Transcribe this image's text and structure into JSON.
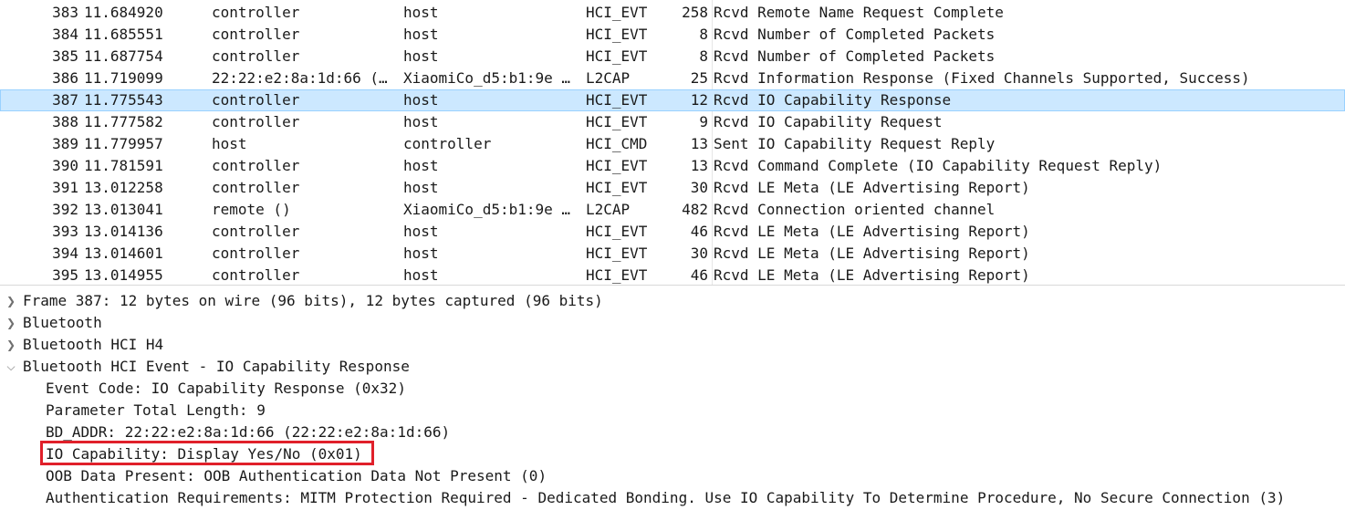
{
  "packets": [
    {
      "no": "383",
      "time": "11.684920",
      "source": "controller",
      "destination": "host",
      "protocol": "HCI_EVT",
      "length": "258",
      "info": "Rcvd Remote Name Request Complete"
    },
    {
      "no": "384",
      "time": "11.685551",
      "source": "controller",
      "destination": "host",
      "protocol": "HCI_EVT",
      "length": "8",
      "info": "Rcvd Number of Completed Packets"
    },
    {
      "no": "385",
      "time": "11.687754",
      "source": "controller",
      "destination": "host",
      "protocol": "HCI_EVT",
      "length": "8",
      "info": "Rcvd Number of Completed Packets"
    },
    {
      "no": "386",
      "time": "11.719099",
      "source": "22:22:e2:8a:1d:66 (…",
      "destination": "XiaomiCo_d5:b1:9e …",
      "protocol": "L2CAP",
      "length": "25",
      "info": "Rcvd Information Response (Fixed Channels Supported, Success)"
    },
    {
      "no": "387",
      "time": "11.775543",
      "source": "controller",
      "destination": "host",
      "protocol": "HCI_EVT",
      "length": "12",
      "info": "Rcvd IO Capability Response"
    },
    {
      "no": "388",
      "time": "11.777582",
      "source": "controller",
      "destination": "host",
      "protocol": "HCI_EVT",
      "length": "9",
      "info": "Rcvd IO Capability Request"
    },
    {
      "no": "389",
      "time": "11.779957",
      "source": "host",
      "destination": "controller",
      "protocol": "HCI_CMD",
      "length": "13",
      "info": "Sent IO Capability Request Reply"
    },
    {
      "no": "390",
      "time": "11.781591",
      "source": "controller",
      "destination": "host",
      "protocol": "HCI_EVT",
      "length": "13",
      "info": "Rcvd Command Complete (IO Capability Request Reply)"
    },
    {
      "no": "391",
      "time": "13.012258",
      "source": "controller",
      "destination": "host",
      "protocol": "HCI_EVT",
      "length": "30",
      "info": "Rcvd LE Meta (LE Advertising Report)"
    },
    {
      "no": "392",
      "time": "13.013041",
      "source": "remote ()",
      "destination": "XiaomiCo_d5:b1:9e …",
      "protocol": "L2CAP",
      "length": "482",
      "info": "Rcvd Connection oriented channel"
    },
    {
      "no": "393",
      "time": "13.014136",
      "source": "controller",
      "destination": "host",
      "protocol": "HCI_EVT",
      "length": "46",
      "info": "Rcvd LE Meta (LE Advertising Report)"
    },
    {
      "no": "394",
      "time": "13.014601",
      "source": "controller",
      "destination": "host",
      "protocol": "HCI_EVT",
      "length": "30",
      "info": "Rcvd LE Meta (LE Advertising Report)"
    },
    {
      "no": "395",
      "time": "13.014955",
      "source": "controller",
      "destination": "host",
      "protocol": "HCI_EVT",
      "length": "46",
      "info": "Rcvd LE Meta (LE Advertising Report)"
    }
  ],
  "selected_packet": "387",
  "details": {
    "frame": "Frame 387: 12 bytes on wire (96 bits), 12 bytes captured (96 bits)",
    "bluetooth": "Bluetooth",
    "hci_h4": "Bluetooth HCI H4",
    "hci_event": "Bluetooth HCI Event - IO Capability Response",
    "fields": {
      "event_code": "Event Code: IO Capability Response (0x32)",
      "param_length": "Parameter Total Length: 9",
      "bd_addr": "BD_ADDR: 22:22:e2:8a:1d:66 (22:22:e2:8a:1d:66)",
      "io_capability": "IO Capability: Display Yes/No (0x01)",
      "oob": "OOB Data Present: OOB Authentication Data Not Present (0)",
      "auth_req": "Authentication Requirements: MITM Protection Required - Dedicated Bonding. Use IO Capability To Determine Procedure, No Secure Connection (3)"
    }
  },
  "icons": {
    "collapsed": "chevron-right-icon",
    "expanded": "chevron-down-icon"
  },
  "colors": {
    "selection": "#cce8ff",
    "highlight": "#e0202a"
  }
}
